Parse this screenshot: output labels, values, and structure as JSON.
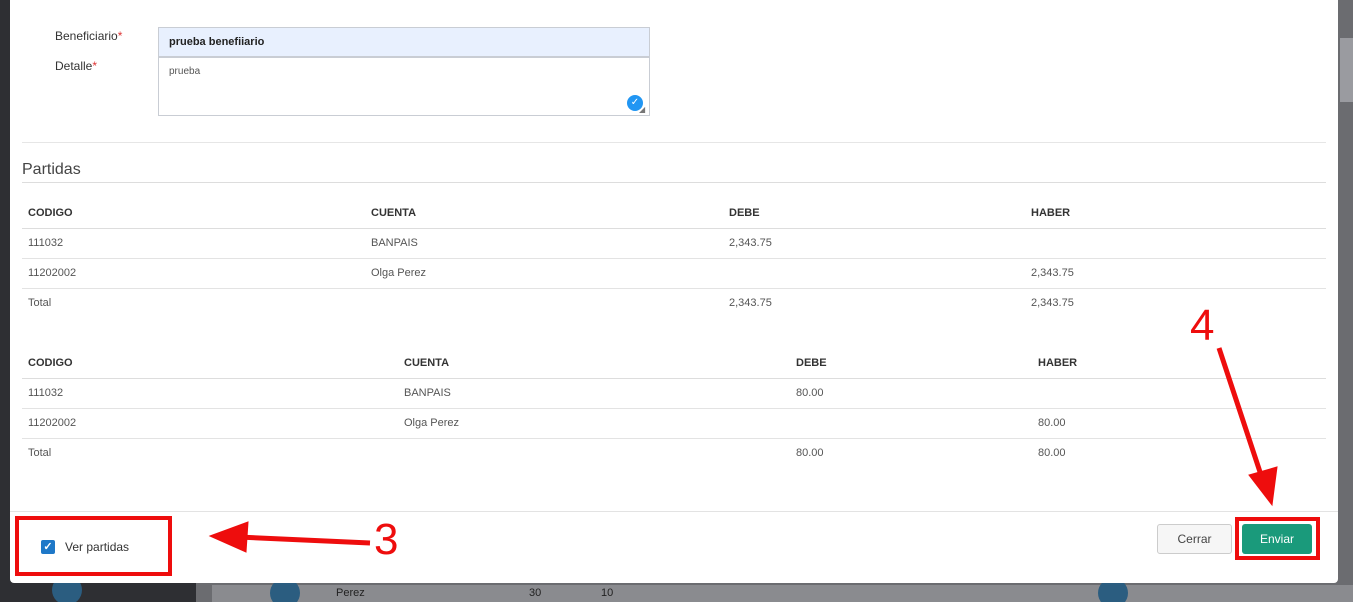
{
  "form": {
    "beneficiario_label": "Beneficiario",
    "beneficiario_value": "prueba benefiiario",
    "detalle_label": "Detalle",
    "detalle_value": "prueba",
    "required_mark": "*"
  },
  "partidas": {
    "title": "Partidas",
    "tables": [
      {
        "headers": [
          "CODIGO",
          "CUENTA",
          "DEBE",
          "HABER"
        ],
        "rows": [
          [
            "111032",
            "BANPAIS",
            "2,343.75",
            ""
          ],
          [
            "11202002",
            "Olga Perez",
            "",
            "2,343.75"
          ],
          [
            "Total",
            "",
            "2,343.75",
            "2,343.75"
          ]
        ]
      },
      {
        "headers": [
          "CODIGO",
          "CUENTA",
          "DEBE",
          "HABER"
        ],
        "rows": [
          [
            "111032",
            "BANPAIS",
            "80.00",
            ""
          ],
          [
            "11202002",
            "Olga Perez",
            "",
            "80.00"
          ],
          [
            "Total",
            "",
            "80.00",
            "80.00"
          ]
        ]
      }
    ]
  },
  "footer": {
    "ver_partidas_label": "Ver partidas",
    "ver_partidas_checked": true,
    "cerrar_label": "Cerrar",
    "enviar_label": "Enviar"
  },
  "annotations": {
    "step3": "3",
    "step4": "4",
    "color": "#ee0d0d"
  },
  "background": {
    "row_name": "Perez",
    "row_val1": "30",
    "row_val2": "10"
  },
  "colors": {
    "primary_button": "#1a9a7b",
    "checkbox": "#1e78c8",
    "input_filled": "#e8f0fe"
  }
}
